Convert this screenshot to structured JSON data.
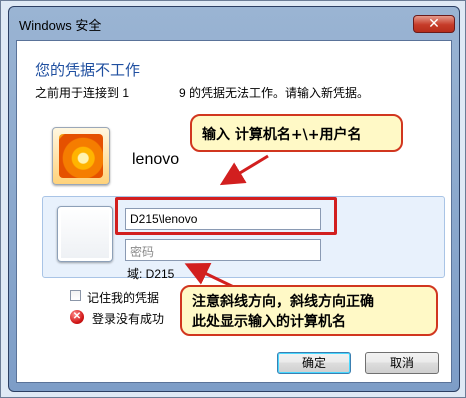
{
  "window": {
    "title": "Windows 安全",
    "close_glyph": "✕"
  },
  "header": {
    "heading": "您的凭据不工作",
    "line_part1": "之前用于连接到 1",
    "line_part2": "9 的凭据无法工作。请输入新凭据。"
  },
  "saved_user": {
    "name": "lenovo"
  },
  "credentials": {
    "username_value": "D215\\lenovo",
    "password_placeholder": "密码",
    "domain_label": "域: D215"
  },
  "options": {
    "remember_label": "记住我的凭据",
    "remember_checked": false
  },
  "status": {
    "error_text": "登录没有成功",
    "error_glyph": "✕"
  },
  "buttons": {
    "ok_label": "确定",
    "cancel_label": "取消"
  },
  "annotations": {
    "callout_top": "输入 计算机名+\\+用户名",
    "callout_bottom_line1": "注意斜线方向，斜线方向正确",
    "callout_bottom_line2": "此处显示输入的计算机名",
    "highlight_color": "#d21f1f",
    "callout_fill": "#fff9c6"
  },
  "colors": {
    "heading_blue": "#1f4fa0",
    "panel_bg": "#e8f1fc",
    "window_frame": "#7d9dc7"
  }
}
